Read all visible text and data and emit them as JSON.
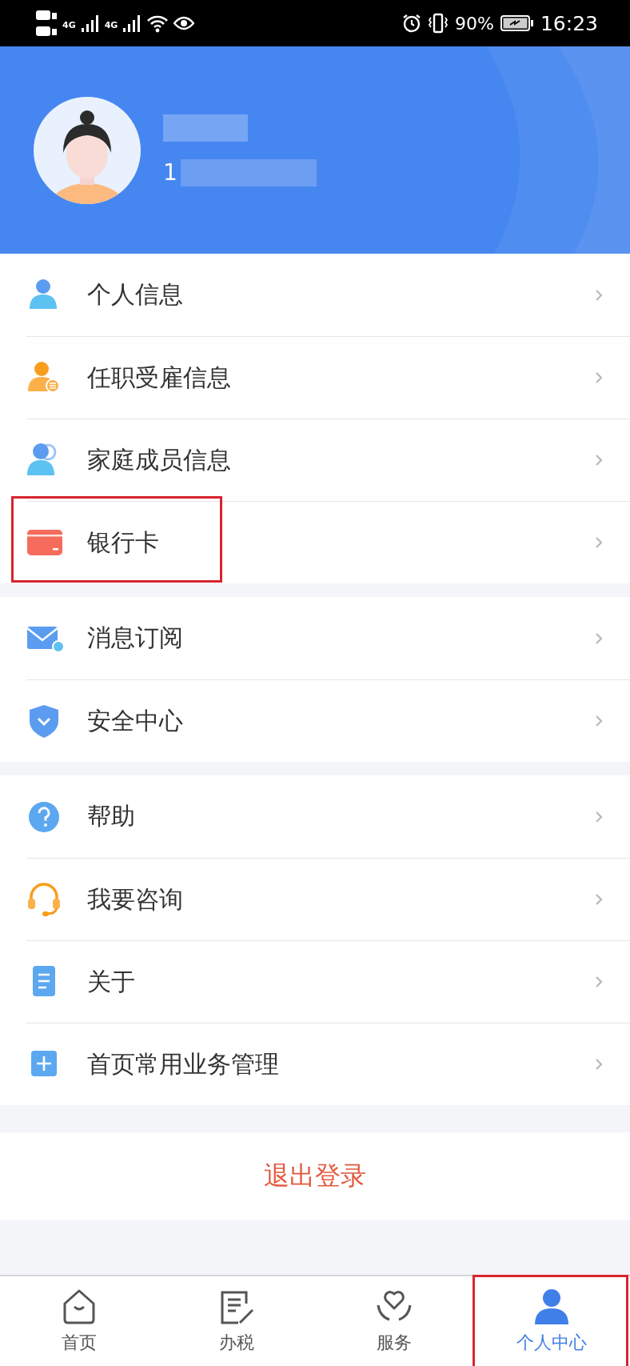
{
  "status_bar": {
    "network_1": "4G",
    "network_2": "4G",
    "battery": "90%",
    "time": "16:23"
  },
  "profile": {
    "phone": "1"
  },
  "menu_groups": [
    {
      "items": [
        {
          "label": "个人信息",
          "highlighted": false
        },
        {
          "label": "任职受雇信息",
          "highlighted": false
        },
        {
          "label": "家庭成员信息",
          "highlighted": false
        },
        {
          "label": "银行卡",
          "highlighted": true
        }
      ]
    },
    {
      "items": [
        {
          "label": "消息订阅",
          "highlighted": false
        },
        {
          "label": "安全中心",
          "highlighted": false
        }
      ]
    },
    {
      "items": [
        {
          "label": "帮助",
          "highlighted": false
        },
        {
          "label": "我要咨询",
          "highlighted": false
        },
        {
          "label": "关于",
          "highlighted": false
        },
        {
          "label": "首页常用业务管理",
          "highlighted": false
        }
      ]
    }
  ],
  "logout_button": "退出登录",
  "tabs": [
    {
      "label": "首页",
      "selected": false,
      "highlighted": false
    },
    {
      "label": "办税",
      "selected": false,
      "highlighted": false
    },
    {
      "label": "服务",
      "selected": false,
      "highlighted": false
    },
    {
      "label": "个人中心",
      "selected": true,
      "highlighted": true
    }
  ]
}
